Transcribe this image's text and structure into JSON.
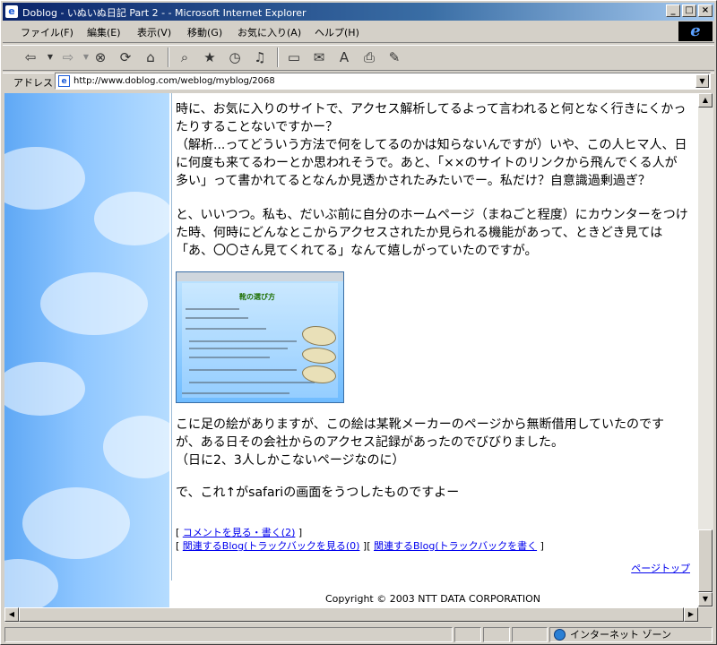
{
  "window": {
    "title": "Doblog - いぬいぬ日記 Part 2 - - Microsoft Internet Explorer",
    "app_icon_glyph": "e"
  },
  "menu": [
    "ファイル(F)",
    "編集(E)",
    "表示(V)",
    "移動(G)",
    "お気に入り(A)",
    "ヘルプ(H)"
  ],
  "address": {
    "label": "アドレス",
    "url": "http://www.doblog.com/weblog/myblog/2068"
  },
  "article": {
    "paragraphs": [
      [
        "時に、お気に入りのサイトで、アクセス解析してるよって言われると何となく行きにくかっ",
        "たりすることないですかー？",
        "（解析...ってどういう方法で何をしてるのかは知らないんですが）いや、この人ヒマ人、日",
        "に何度も来てるわーとか思われそうで。あと、「××のサイトのリンクから飛んでくる人が",
        "多い」って書かれてるとなんか見透かされたみたいでー。私だけ？自意識過剰過ぎ？"
      ],
      [
        "と、いいつつ。私も、だいぶ前に自分のホームページ（まねごと程度）にカウンターをつけ",
        "た時、何時にどんなとこからアクセスされたか見られる機能があって、ときどき見ては",
        "「あ、〇〇さん見てくれてる」なんて嬉しがっていたのですが。"
      ],
      [
        "こに足の絵がありますが、この絵は某靴メーカーのページから無断借用していたのです",
        "が、ある日その会社からのアクセス記録があったのでびびりました。",
        "（日に2、3人しかこないページなのに）"
      ],
      [
        "で、これ↑がsafariの画面をうつしたものですよー"
      ]
    ],
    "screenshot_title": "靴の選び方"
  },
  "links": {
    "comment": "コメントを見る・書く(2)",
    "trackback_view": "関連するBlog(トラックバックを見る(0)",
    "trackback_write": "関連するBlog(トラックバックを書く",
    "page_top": "ページトップ"
  },
  "footer": {
    "copyright": "Copyright © 2003 NTT DATA CORPORATION"
  },
  "status": {
    "zone": "インターネット ゾーン"
  }
}
